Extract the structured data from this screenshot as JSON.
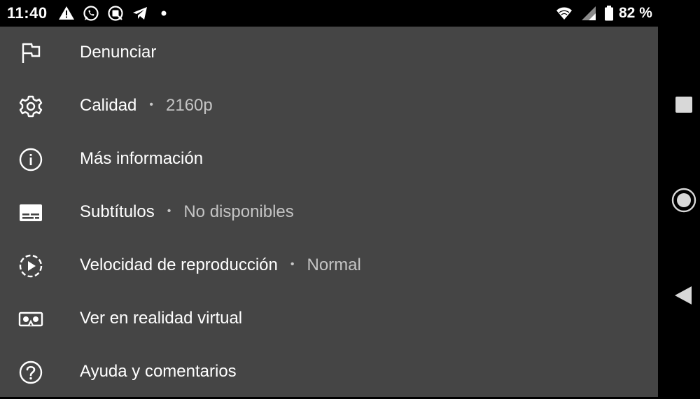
{
  "status_bar": {
    "time": "11:40",
    "battery_percent": "82 %",
    "icons": [
      "warning-icon",
      "whatsapp-icon",
      "messages-icon",
      "telegram-icon",
      "notification-dot-icon",
      "wifi-icon",
      "signal-icon",
      "battery-icon"
    ]
  },
  "menu": {
    "items": [
      {
        "label": "Denunciar",
        "icon": "flag-icon"
      },
      {
        "label": "Calidad",
        "separator": "•",
        "value": "2160p",
        "icon": "gear-icon"
      },
      {
        "label": "Más información",
        "icon": "info-icon"
      },
      {
        "label": "Subtítulos",
        "separator": "•",
        "value": "No disponibles",
        "icon": "subtitles-icon"
      },
      {
        "label": "Velocidad de reproducción",
        "separator": "•",
        "value": "Normal",
        "icon": "playback-speed-icon"
      },
      {
        "label": "Ver en realidad virtual",
        "icon": "vr-headset-icon"
      },
      {
        "label": "Ayuda y comentarios",
        "icon": "help-icon"
      }
    ]
  },
  "navigation": {
    "buttons": [
      "recents-button",
      "home-button",
      "back-button"
    ]
  },
  "colors": {
    "sheet_background": "#454545",
    "text_primary": "#ffffff",
    "text_secondary": "#c4c4c4",
    "system_bars": "#000000"
  }
}
